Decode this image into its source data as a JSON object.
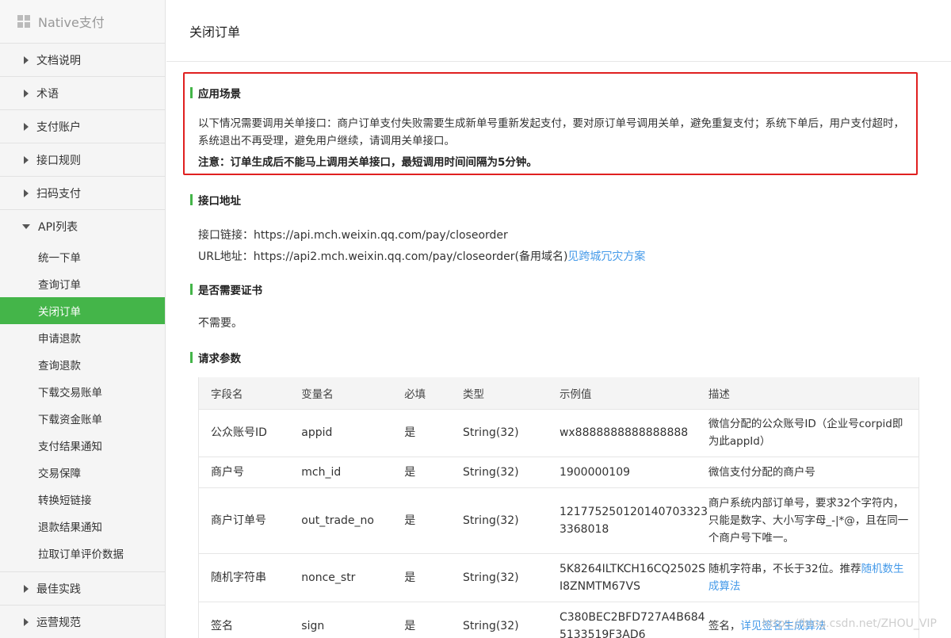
{
  "sidebar": {
    "title": "Native支付",
    "groups_top": [
      {
        "label": "文档说明"
      },
      {
        "label": "术语"
      },
      {
        "label": "支付账户"
      },
      {
        "label": "接口规则"
      },
      {
        "label": "扫码支付"
      }
    ],
    "api_group": {
      "label": "API列表",
      "items": [
        {
          "label": "统一下单"
        },
        {
          "label": "查询订单"
        },
        {
          "label": "关闭订单"
        },
        {
          "label": "申请退款"
        },
        {
          "label": "查询退款"
        },
        {
          "label": "下载交易账单"
        },
        {
          "label": "下载资金账单"
        },
        {
          "label": "支付结果通知"
        },
        {
          "label": "交易保障"
        },
        {
          "label": "转换短链接"
        },
        {
          "label": "退款结果通知"
        },
        {
          "label": "拉取订单评价数据"
        }
      ],
      "active_index": 2
    },
    "groups_bottom": [
      {
        "label": "最佳实践"
      },
      {
        "label": "运营规范"
      }
    ]
  },
  "page": {
    "title": "关闭订单"
  },
  "scene": {
    "heading": "应用场景",
    "description": "以下情况需要调用关单接口：商户订单支付失败需要生成新单号重新发起支付，要对原订单号调用关单，避免重复支付；系统下单后，用户支付超时，系统退出不再受理，避免用户继续，请调用关单接口。",
    "note": "注意：订单生成后不能马上调用关单接口，最短调用时间间隔为5分钟。"
  },
  "address": {
    "heading": "接口地址",
    "line1": "接口链接：https://api.mch.weixin.qq.com/pay/closeorder",
    "line2_text": "URL地址：https://api2.mch.weixin.qq.com/pay/closeorder(备用域名)",
    "line2_link": "见跨城冗灾方案"
  },
  "cert": {
    "heading": "是否需要证书",
    "value": "不需要。"
  },
  "params": {
    "heading": "请求参数",
    "columns": [
      "字段名",
      "变量名",
      "必填",
      "类型",
      "示例值",
      "描述"
    ],
    "rows": [
      {
        "field": "公众账号ID",
        "var": "appid",
        "required": "是",
        "type": "String(32)",
        "example": "wx8888888888888888",
        "desc": "微信分配的公众账号ID（企业号corpid即为此appId）",
        "desc_link": ""
      },
      {
        "field": "商户号",
        "var": "mch_id",
        "required": "是",
        "type": "String(32)",
        "example": "1900000109",
        "desc": "微信支付分配的商户号",
        "desc_link": ""
      },
      {
        "field": "商户订单号",
        "var": "out_trade_no",
        "required": "是",
        "type": "String(32)",
        "example": "1217752501201407033233368018",
        "desc": "商户系统内部订单号，要求32个字符内，只能是数字、大小写字母_-|*@，且在同一个商户号下唯一。",
        "desc_link": ""
      },
      {
        "field": "随机字符串",
        "var": "nonce_str",
        "required": "是",
        "type": "String(32)",
        "example": "5K8264ILTKCH16CQ2502SI8ZNMTM67VS",
        "desc": "随机字符串，不长于32位。推荐",
        "desc_link": "随机数生成算法"
      },
      {
        "field": "签名",
        "var": "sign",
        "required": "是",
        "type": "String(32)",
        "example": "C380BEC2BFD727A4B6845133519F3AD6",
        "desc": "签名，",
        "desc_link": "详见签名生成算法"
      }
    ]
  },
  "watermark": "https://blog.csdn.net/ZHOU_VIP",
  "colors": {
    "accent": "#44b549",
    "highlight_border": "#e02020",
    "link": "#459ae9"
  }
}
